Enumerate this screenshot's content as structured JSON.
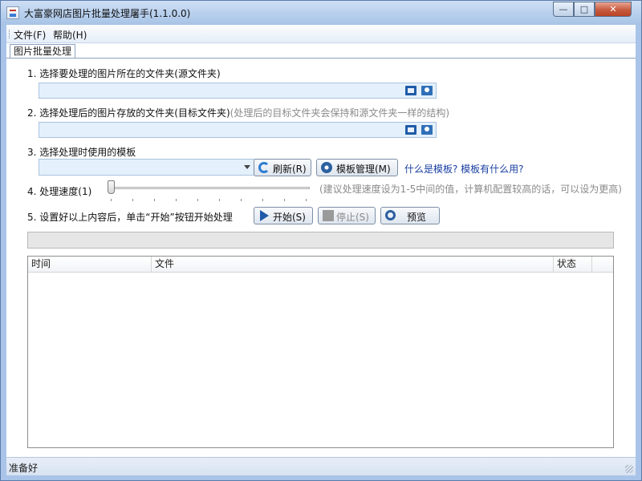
{
  "window": {
    "title": "大富豪网店图片批量处理屠手(1.1.0.0)",
    "controls": {
      "minimize": "—",
      "maximize": "□",
      "close": "✕"
    }
  },
  "menu": {
    "items": [
      {
        "label": "文件(F)"
      },
      {
        "label": "帮助(H)"
      }
    ]
  },
  "tab": {
    "label": "图片批量处理"
  },
  "form": {
    "step1_label": "1. 选择要处理的图片所在的文件夹(源文件夹)",
    "source_folder_value": "",
    "step2_label": "2. 选择处理后的图片存放的文件夹(目标文件夹)",
    "step2_hint": "(处理后的目标文件夹会保持和源文件夹一样的结构)",
    "target_folder_value": "",
    "step3_label": "3. 选择处理时使用的模板",
    "template_value": "",
    "refresh_label": "刷新(R)",
    "template_manage_label": "模板管理(M)",
    "template_help_link": "什么是模板? 模板有什么用?",
    "step4_label": "4. 处理速度(1)",
    "speed_value": 1,
    "speed_hint": "(建议处理速度设为1-5中间的值，计算机配置较高的话，可以设为更高)",
    "step5_label": "5. 设置好以上内容后，单击“开始”按钮开始处理",
    "start_label": "开始(S)",
    "stop_label": "停止(S)",
    "preview_label": "预览"
  },
  "progress": {
    "value": 0
  },
  "table": {
    "columns": [
      "时间",
      "文件",
      "状态"
    ],
    "rows": []
  },
  "status": {
    "text": "准备好"
  },
  "icons": {
    "app": "app-icon",
    "open_folder": "folder-open-icon",
    "browse_folder": "folder-browse-icon",
    "refresh": "refresh-icon",
    "settings": "gear-icon",
    "start": "play-icon",
    "stop": "stop-icon",
    "preview": "magnifier-icon"
  },
  "colors": {
    "titlebar": "#b9d1ee",
    "input_bg": "#e4f0fb",
    "link": "#1a3fa0",
    "hint": "#8a8a8a"
  }
}
